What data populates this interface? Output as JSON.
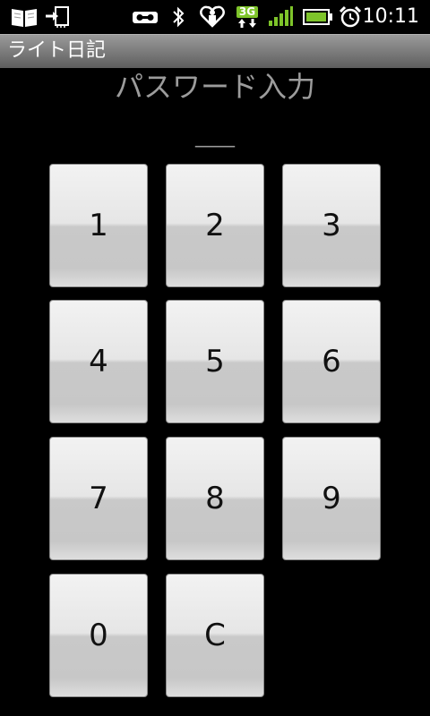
{
  "status_bar": {
    "time": "10:11",
    "network_label": "3G",
    "icons": [
      "book-icon",
      "exit-icon",
      "voicemail-icon",
      "bluetooth-icon",
      "heart-app-icon",
      "network-3g-icon",
      "signal-icon",
      "battery-icon",
      "alarm-icon"
    ]
  },
  "title_bar": {
    "title": "ライト日記"
  },
  "password": {
    "heading": "パスワード入力",
    "display": "____"
  },
  "keypad": {
    "keys": [
      "1",
      "2",
      "3",
      "4",
      "5",
      "6",
      "7",
      "8",
      "9",
      "0",
      "C"
    ]
  },
  "colors": {
    "background": "#000000",
    "heading_text": "#9c9c9c",
    "key_face": "#e6e6e6",
    "battery_green": "#7ec42a",
    "signal_green": "#7ec42a"
  }
}
